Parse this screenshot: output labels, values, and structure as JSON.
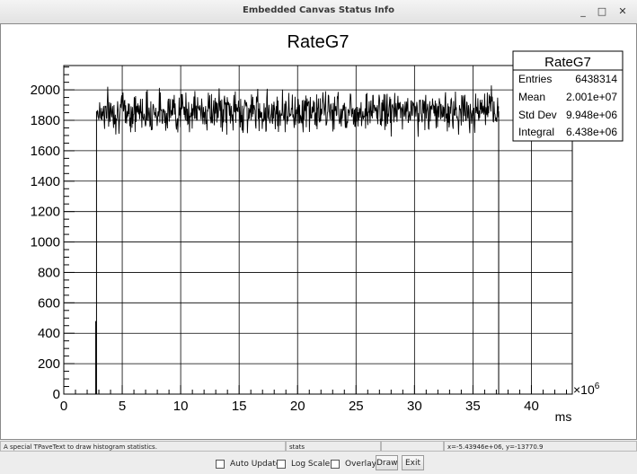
{
  "window": {
    "title": "Embedded Canvas Status Info",
    "controls": {
      "minimize": "_",
      "maximize": "□",
      "close": "✕"
    }
  },
  "status_bar": {
    "info": "A special TPaveText to draw histogram statistics.",
    "object": "stats",
    "extra": "",
    "coords": "x=-5.43946e+06, y=-13770.9"
  },
  "controls": {
    "auto_update": {
      "label": "Auto Update",
      "checked": false
    },
    "log_scale": {
      "label": "Log Scale",
      "checked": false
    },
    "overlay": {
      "label": "Overlay",
      "checked": false
    },
    "draw_label": "Draw",
    "exit_label": "Exit"
  },
  "stats_box": {
    "title": "RateG7",
    "rows": [
      {
        "label": "Entries",
        "value": "6438314"
      },
      {
        "label": "Mean",
        "value": "2.001e+07"
      },
      {
        "label": "Std Dev",
        "value": "9.948e+06"
      },
      {
        "label": "Integral",
        "value": "6.438e+06"
      }
    ]
  },
  "chart_data": {
    "type": "line",
    "title": "RateG7",
    "xlabel": "ms",
    "x_exponent_label": "×10",
    "x_exponent": "6",
    "ylabel": "",
    "xlim": [
      0,
      43.5
    ],
    "ylim": [
      0,
      2160
    ],
    "x_ticks": [
      "0",
      "5",
      "10",
      "15",
      "20",
      "25",
      "30",
      "35",
      "40"
    ],
    "y_ticks": [
      "0",
      "200",
      "400",
      "600",
      "800",
      "1000",
      "1200",
      "1400",
      "1600",
      "1800",
      "2000"
    ],
    "grid": true,
    "series": [
      {
        "x_range": [
          2.8,
          37.2
        ],
        "mean": 1860,
        "band": [
          1720,
          1960
        ],
        "note_start_spike": {
          "x": 2.8,
          "y": 480
        }
      }
    ]
  }
}
